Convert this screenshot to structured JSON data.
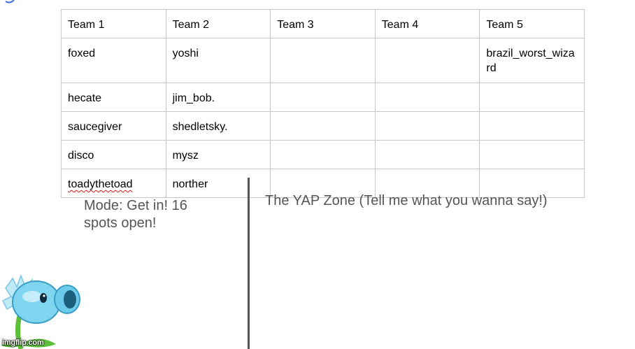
{
  "table": {
    "headers": [
      "Team 1",
      "Team 2",
      "Team 3",
      "Team 4",
      "Team 5"
    ],
    "rows": [
      [
        "foxed",
        "yoshi",
        "",
        "",
        "brazil_worst_wizard"
      ],
      [
        "hecate",
        "jim_bob.",
        "",
        "",
        ""
      ],
      [
        "saucegiver",
        "shedletsky.",
        "",
        "",
        ""
      ],
      [
        "disco",
        "mysz",
        "",
        "",
        ""
      ],
      [
        "toadythetoad",
        "norther",
        "",
        "",
        ""
      ]
    ]
  },
  "mode_text": "Mode: Get in! 16 spots open!",
  "yap_text": "The YAP Zone (Tell me what you wanna say!)",
  "watermark": "imgflip.com",
  "colors": {
    "border": "#c8c8c8",
    "note_text": "#555555",
    "divider": "#555555",
    "plant_head": "#7fd4f0",
    "plant_stem": "#5cbf3a"
  },
  "icons": {
    "corner": "blue-arrow-fragment-icon",
    "plant": "snow-pea-plant-icon"
  }
}
